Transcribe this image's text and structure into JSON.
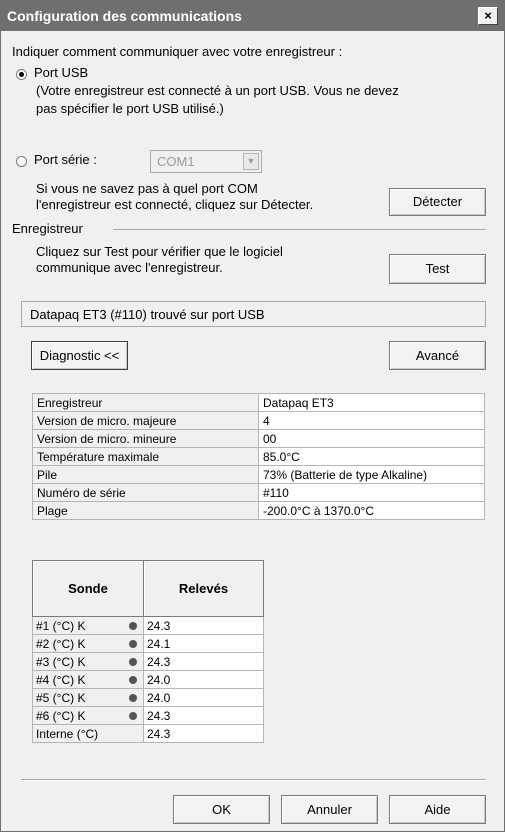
{
  "window": {
    "title": "Configuration des communications",
    "close_label": "×"
  },
  "intro": "Indiquer comment communiquer avec votre enregistreur :",
  "usb": {
    "label": "Port USB",
    "desc1": "(Votre enregistreur est connecté à un port USB. Vous ne devez",
    "desc2": "pas spécifier le port USB utilisé.)",
    "selected": true
  },
  "serial": {
    "label": "Port série :",
    "combo_value": "COM1",
    "help1": "Si vous ne savez pas à quel port COM",
    "help2": "l'enregistreur est connecté, cliquez sur Détecter.",
    "detect_label": "Détecter"
  },
  "logger_group": {
    "title": "Enregistreur",
    "help1": "Cliquez sur Test pour vérifier que le logiciel",
    "help2": "communique avec l'enregistreur.",
    "test_label": "Test"
  },
  "status": "Datapaq ET3 (#110) trouvé sur port USB",
  "buttons": {
    "diagnostic": "Diagnostic <<",
    "advanced": "Avancé",
    "ok": "OK",
    "cancel": "Annuler",
    "help": "Aide"
  },
  "info_rows": [
    {
      "key": "Enregistreur",
      "value": "Datapaq ET3"
    },
    {
      "key": "Version de micro. majeure",
      "value": "4"
    },
    {
      "key": "Version de micro. mineure",
      "value": "00"
    },
    {
      "key": "Température maximale",
      "value": "85.0°C"
    },
    {
      "key": "Pile",
      "value": "73% (Batterie de type Alkaline)"
    },
    {
      "key": "Numéro de série",
      "value": "#110"
    },
    {
      "key": "Plage",
      "value": "-200.0°C à 1370.0°C"
    }
  ],
  "probes": {
    "headers": {
      "probe": "Sonde",
      "readings": "Relevés"
    },
    "rows": [
      {
        "name": "#1 (°C)  K",
        "value": "24.3",
        "dot": true
      },
      {
        "name": "#2 (°C)  K",
        "value": "24.1",
        "dot": true
      },
      {
        "name": "#3 (°C)  K",
        "value": "24.3",
        "dot": true
      },
      {
        "name": "#4 (°C)  K",
        "value": "24.0",
        "dot": true
      },
      {
        "name": "#5 (°C)  K",
        "value": "24.0",
        "dot": true
      },
      {
        "name": "#6 (°C)  K",
        "value": "24.3",
        "dot": true
      },
      {
        "name": "Interne (°C)",
        "value": "24.3",
        "dot": false
      }
    ]
  }
}
